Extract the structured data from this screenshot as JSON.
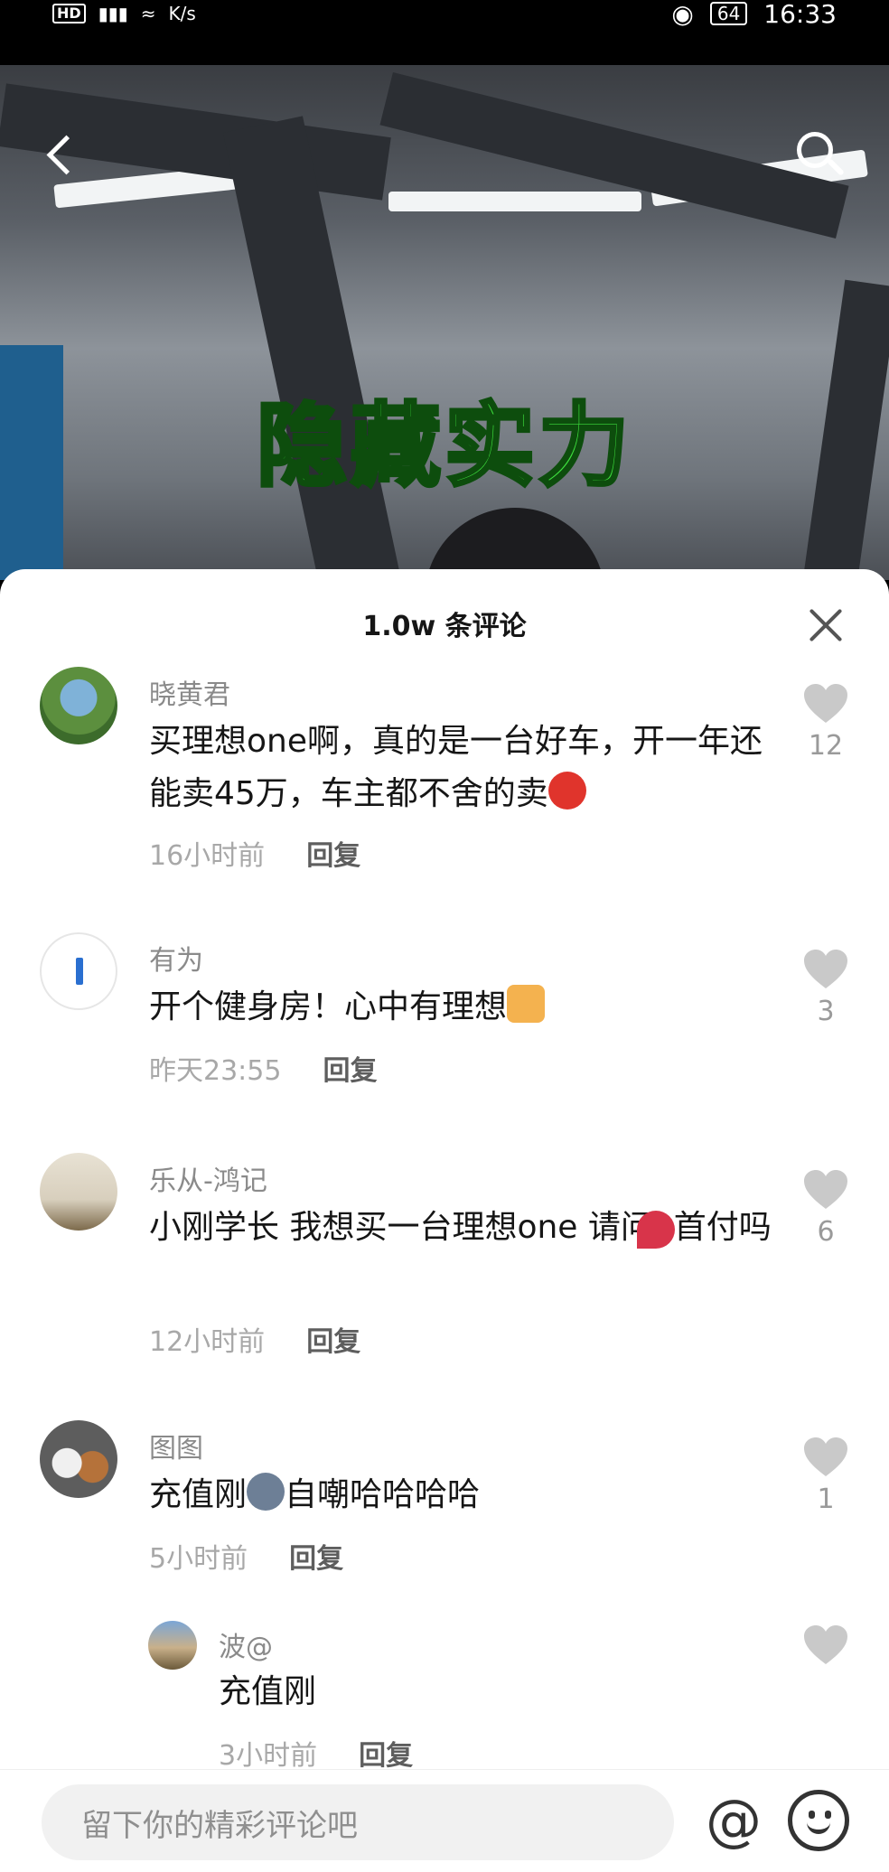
{
  "status_bar": {
    "hd": "HD",
    "net_speed": "K/s",
    "battery": "64",
    "time": "16:33"
  },
  "video": {
    "caption": "隐藏实力"
  },
  "comments_panel": {
    "title": "1.0w 条评论",
    "comments": [
      {
        "author": "晓黄君",
        "text": "买理想one啊，真的是一台好车，开一年还能卖45万，车主都不舍的卖",
        "time": "16小时前",
        "reply_label": "回复",
        "likes": "12"
      },
      {
        "author": "有为",
        "text": "开个健身房！心中有理想",
        "time": "昨天23:55",
        "reply_label": "回复",
        "likes": "3"
      },
      {
        "author": "乐从-鸿记",
        "text": "小刚学长 我想买一台理想one  请问0首付吗",
        "time": "12小时前",
        "reply_label": "回复",
        "likes": "6"
      },
      {
        "author": "图图",
        "text_before": "充值刚",
        "text_after": "自嘲哈哈哈哈",
        "time": "5小时前",
        "reply_label": "回复",
        "likes": "1"
      }
    ],
    "sub_reply": {
      "author": "波@",
      "text": "充值刚",
      "time": "3小时前",
      "reply_label": "回复"
    }
  },
  "input_bar": {
    "placeholder": "留下你的精彩评论吧",
    "at_label": "@"
  },
  "colors": {
    "caption_green": "#3ee03e",
    "heart_gray": "#c9c9c9"
  }
}
